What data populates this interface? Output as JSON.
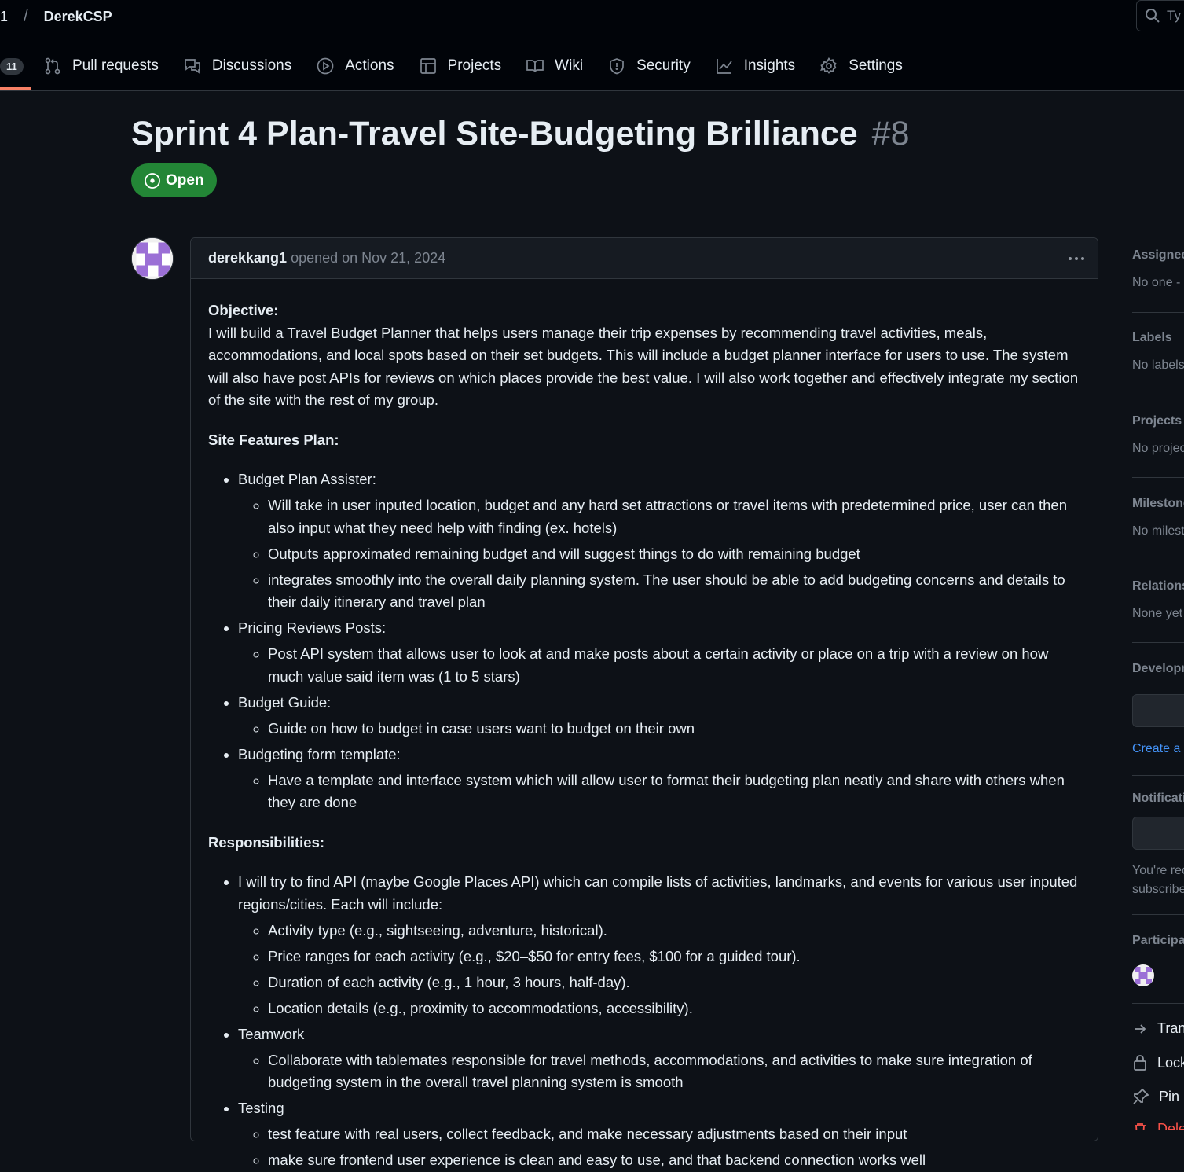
{
  "header": {
    "crumb_num": "1",
    "crumb_sep": "/",
    "owner": "DerekCSP",
    "search_placeholder": "Ty"
  },
  "repo_nav": {
    "issues_count": "11",
    "items": [
      "Pull requests",
      "Discussions",
      "Actions",
      "Projects",
      "Wiki",
      "Security",
      "Insights",
      "Settings"
    ]
  },
  "issue": {
    "title": "Sprint 4 Plan-Travel Site-Budgeting Brilliance",
    "number": "#8",
    "state": "Open",
    "author": "derekkang1",
    "opened": "opened on Nov 21, 2024"
  },
  "body": {
    "objective_heading": "Objective:",
    "objective_text": "I will build a Travel Budget Planner that helps users manage their trip expenses by recommending travel activities, meals, accommodations, and local spots based on their set budgets. This will include a budget planner interface for users to use. The system will also have post APIs for reviews on which places provide the best value. I will also work together and effectively integrate my section of the site with the rest of my group.",
    "features_heading": "Site Features Plan:",
    "features": [
      {
        "label": "Budget Plan Assister:",
        "sub": [
          "Will take in user inputed location, budget and any hard set attractions or travel items with predetermined price, user can then also input what they need help with finding (ex. hotels)",
          "Outputs approximated remaining budget and will suggest things to do with remaining budget",
          "integrates smoothly into the overall daily planning system. The user should be able to add budgeting concerns and details to their daily itinerary and travel plan"
        ]
      },
      {
        "label": "Pricing Reviews Posts:",
        "sub": [
          "Post API system that allows user to look at and make posts about a certain activity or place on a trip with a review on how much value said item was (1 to 5 stars)"
        ]
      },
      {
        "label": "Budget Guide:",
        "sub": [
          "Guide on how to budget in case users want to budget on their own"
        ]
      },
      {
        "label": "Budgeting form template:",
        "sub": [
          "Have a template and interface system which will allow user to format their budgeting plan neatly and share with others when they are done"
        ]
      }
    ],
    "resp_heading": "Responsibilities:",
    "responsibilities": [
      {
        "label": "I will try to find API (maybe Google Places API) which can compile lists of activities, landmarks, and events for various user inputed regions/cities. Each will include:",
        "sub": [
          "Activity type (e.g., sightseeing, adventure, historical).",
          "Price ranges for each activity (e.g., $20–$50 for entry fees, $100 for a guided tour).",
          "Duration of each activity (e.g., 1 hour, 3 hours, half-day).",
          "Location details (e.g., proximity to accommodations, accessibility)."
        ]
      },
      {
        "label": "Teamwork",
        "sub": [
          "Collaborate with tablemates responsible for travel methods, accommodations, and activities to make sure integration of budgeting system in the overall travel planning system is smooth"
        ]
      },
      {
        "label": "Testing",
        "sub": [
          "test feature with real users, collect feedback, and make necessary adjustments based on their input",
          "make sure frontend user experience is clean and easy to use, and that backend connection works well"
        ]
      }
    ]
  },
  "sidebar": {
    "assignees_head": "Assignees",
    "assignees_val": "No one -",
    "labels_head": "Labels",
    "labels_val": "No labels",
    "projects_head": "Projects",
    "projects_val": "No projects",
    "milestone_head": "Milestone",
    "milestone_val": "No milestone",
    "relations_head": "Relationships",
    "relations_val": "None yet",
    "development_head": "Development",
    "create_link": "Create a branch",
    "notifications_head": "Notifications",
    "notif_text1": "You're receiving",
    "notif_text2": "subscribed",
    "participants_head": "Participants",
    "actions": [
      "Transfer issue",
      "Lock conversation",
      "Pin issue",
      "Delete issue"
    ]
  }
}
